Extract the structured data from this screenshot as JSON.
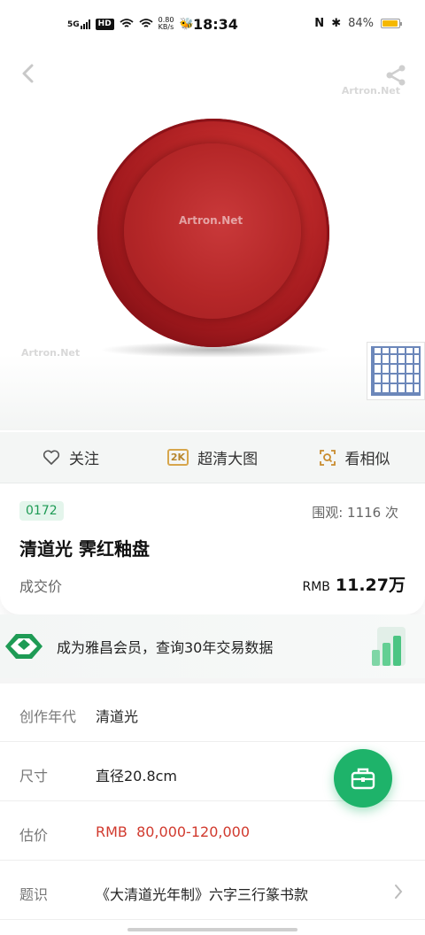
{
  "status_bar": {
    "network": "5G",
    "hd": "HD",
    "speed_value": "0.80",
    "speed_unit": "KB/s",
    "time": "18:34",
    "battery": "84%"
  },
  "image_area": {
    "watermark": "Artron.Net",
    "plate_watermark": "Artron.Net"
  },
  "actions": {
    "follow": "关注",
    "hd_badge": "2K",
    "hd_image": "超清大图",
    "similar": "看相似"
  },
  "lot": {
    "number": "0172",
    "views_label": "围观: 1116 次",
    "title": "清道光 霁红釉盘",
    "price_label": "成交价",
    "currency": "RMB",
    "price": "11.27万"
  },
  "member": {
    "text": "成为雅昌会员，查询30年交易数据"
  },
  "details": [
    {
      "key": "创作年代",
      "value": "清道光"
    },
    {
      "key": "尺寸",
      "value": "直径20.8cm"
    },
    {
      "key": "估价",
      "value": "RMB  80,000-120,000"
    },
    {
      "key": "题识",
      "value": "《大清道光年制》六字三行篆书款"
    }
  ],
  "colors": {
    "brand_green": "#1eb36a",
    "estimate_red": "#d13a2e",
    "lot_badge_green": "#1e9b55"
  },
  "icons": [
    "back-icon",
    "share-icon",
    "heart-icon",
    "search-similar-icon",
    "chevron-right-icon",
    "briefcase-icon"
  ]
}
